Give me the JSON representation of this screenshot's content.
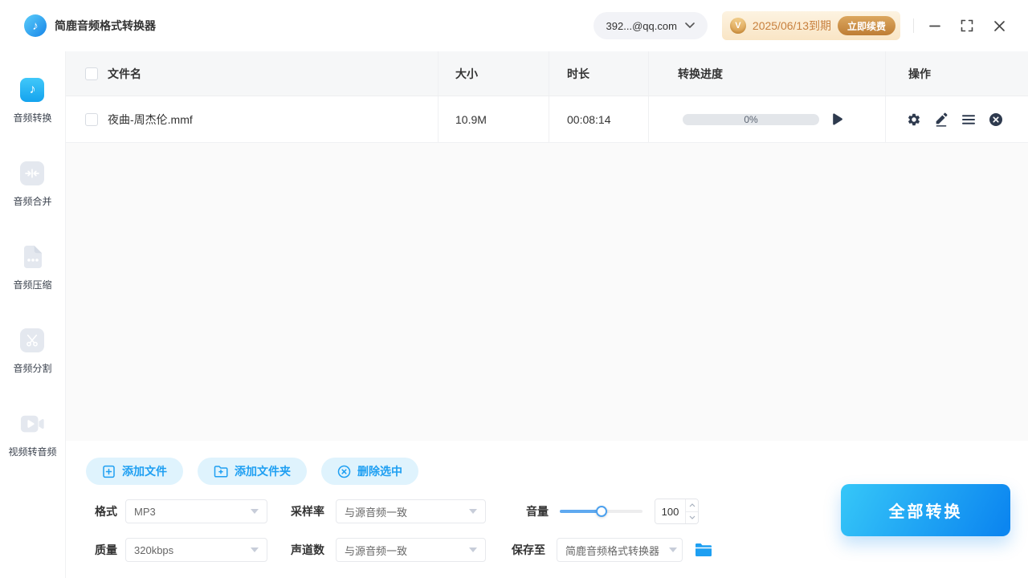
{
  "app": {
    "title": "简鹿音频格式转换器",
    "account": "392...@qq.com",
    "vip": {
      "expiry": "2025/06/13到期",
      "renew_label": "立即续费",
      "badge_glyph": "V"
    }
  },
  "icons": {
    "note_glyph": "♪",
    "logo": "music-note-circle",
    "row_actions": [
      "gear",
      "edit-pencil",
      "menu-lines",
      "remove-circle-x"
    ],
    "accent": "#1E9FF2"
  },
  "sidebar": {
    "items": [
      {
        "id": "audio-convert",
        "label": "音频转换",
        "active": true
      },
      {
        "id": "audio-merge",
        "label": "音频合并",
        "active": false
      },
      {
        "id": "audio-compress",
        "label": "音频压缩",
        "active": false
      },
      {
        "id": "audio-split",
        "label": "音频分割",
        "active": false
      },
      {
        "id": "video-to-audio",
        "label": "视频转音频",
        "active": false
      }
    ]
  },
  "table": {
    "columns": {
      "name": "文件名",
      "size": "大小",
      "duration": "时长",
      "progress": "转换进度",
      "actions": "操作"
    },
    "rows": [
      {
        "name": "夜曲-周杰伦.mmf",
        "size": "10.9M",
        "duration": "00:08:14",
        "progress_label": "0%",
        "progress_percent": 0,
        "checked": false
      }
    ]
  },
  "toolbar": {
    "add_file": "添加文件",
    "add_folder": "添加文件夹",
    "delete_selected": "删除选中"
  },
  "settings": {
    "format": {
      "label": "格式",
      "value": "MP3"
    },
    "sample_rate": {
      "label": "采样率",
      "value": "与源音频一致"
    },
    "volume": {
      "label": "音量",
      "value": "100",
      "slider_percent": 50
    },
    "quality": {
      "label": "质量",
      "value": "320kbps"
    },
    "channels": {
      "label": "声道数",
      "value": "与源音频一致"
    },
    "save_to": {
      "label": "保存至",
      "value": "简鹿音频格式转换器"
    }
  },
  "actions": {
    "convert_all": "全部转换"
  },
  "colors": {
    "accent": "#1E9FF2",
    "convert_gradient_start": "#36C7F8",
    "convert_gradient_end": "#0C86F0",
    "vip_text": "#C8803E",
    "light_button_bg": "#DFF3FD"
  }
}
